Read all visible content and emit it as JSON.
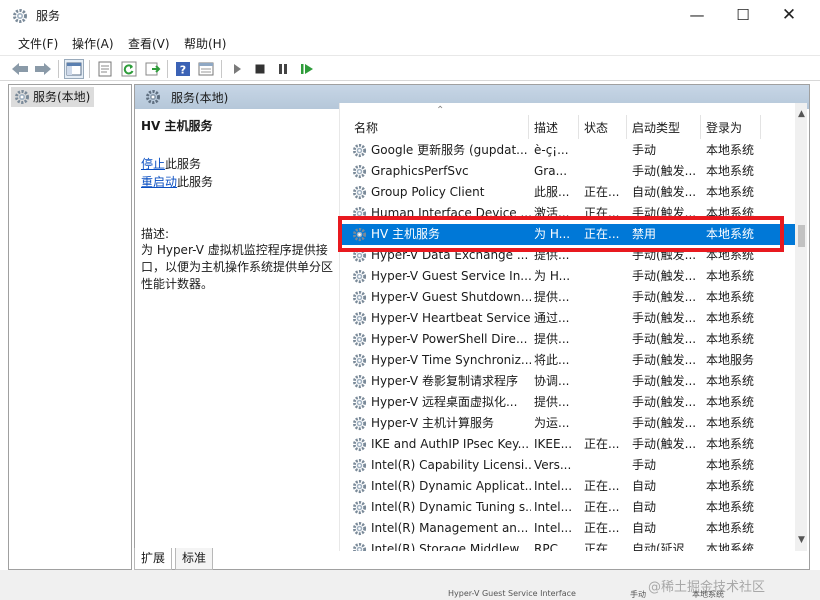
{
  "window": {
    "title": "服务",
    "min_icon": "minimize-icon",
    "max_icon": "maximize-icon",
    "close_icon": "close-icon"
  },
  "menu": [
    "文件(F)",
    "操作(A)",
    "查看(V)",
    "帮助(H)"
  ],
  "toolbar": [
    "back-icon",
    "forward-icon",
    "console-tree-icon",
    "properties-icon",
    "refresh-icon",
    "export-icon",
    "help-icon",
    "details-icon",
    "start-icon",
    "stop-icon",
    "pause-icon",
    "restart-icon"
  ],
  "tree": {
    "item": "服务(本地)"
  },
  "panel": {
    "header": "服务(本地)",
    "detail": {
      "title": "HV 主机服务",
      "stop_link": "停止",
      "stop_suffix": "此服务",
      "restart_link": "重启动",
      "restart_suffix": "此服务",
      "desc_label": "描述:",
      "desc": "为 Hyper-V 虚拟机监控程序提供接口，以便为主机操作系统提供单分区性能计数器。"
    }
  },
  "columns": [
    "名称",
    "描述",
    "状态",
    "启动类型",
    "登录为"
  ],
  "rows": [
    {
      "name": "Google 更新服务 (gupdat...",
      "desc": "è‑ç¡...",
      "status": "",
      "start": "手动",
      "logon": "本地系统"
    },
    {
      "name": "GraphicsPerfSvc",
      "desc": "Gra...",
      "status": "",
      "start": "手动(触发...",
      "logon": "本地系统"
    },
    {
      "name": "Group Policy Client",
      "desc": "此服...",
      "status": "正在...",
      "start": "自动(触发...",
      "logon": "本地系统"
    },
    {
      "name": "Human Interface Device ...",
      "desc": "激活...",
      "status": "正在...",
      "start": "手动(触发...",
      "logon": "本地系统"
    },
    {
      "name": "HV 主机服务",
      "desc": "为 H...",
      "status": "正在...",
      "start": "禁用",
      "logon": "本地系统",
      "selected": true
    },
    {
      "name": "Hyper-V Data Exchange ...",
      "desc": "提供...",
      "status": "",
      "start": "手动(触发...",
      "logon": "本地系统"
    },
    {
      "name": "Hyper-V Guest Service In...",
      "desc": "为 H...",
      "status": "",
      "start": "手动(触发...",
      "logon": "本地系统"
    },
    {
      "name": "Hyper-V Guest Shutdown...",
      "desc": "提供...",
      "status": "",
      "start": "手动(触发...",
      "logon": "本地系统"
    },
    {
      "name": "Hyper-V Heartbeat Service",
      "desc": "通过...",
      "status": "",
      "start": "手动(触发...",
      "logon": "本地系统"
    },
    {
      "name": "Hyper-V PowerShell Dire...",
      "desc": "提供...",
      "status": "",
      "start": "手动(触发...",
      "logon": "本地系统"
    },
    {
      "name": "Hyper-V Time Synchroniz...",
      "desc": "将此...",
      "status": "",
      "start": "手动(触发...",
      "logon": "本地服务"
    },
    {
      "name": "Hyper-V 卷影复制请求程序",
      "desc": "协调...",
      "status": "",
      "start": "手动(触发...",
      "logon": "本地系统"
    },
    {
      "name": "Hyper-V 远程桌面虚拟化...",
      "desc": "提供...",
      "status": "",
      "start": "手动(触发...",
      "logon": "本地系统"
    },
    {
      "name": "Hyper-V 主机计算服务",
      "desc": "为运...",
      "status": "",
      "start": "手动(触发...",
      "logon": "本地系统"
    },
    {
      "name": "IKE and AuthIP IPsec Key...",
      "desc": "IKEE...",
      "status": "正在...",
      "start": "手动(触发...",
      "logon": "本地系统"
    },
    {
      "name": "Intel(R) Capability Licensi...",
      "desc": "Vers...",
      "status": "",
      "start": "手动",
      "logon": "本地系统"
    },
    {
      "name": "Intel(R) Dynamic Applicat...",
      "desc": "Intel...",
      "status": "正在...",
      "start": "自动",
      "logon": "本地系统"
    },
    {
      "name": "Intel(R) Dynamic Tuning s...",
      "desc": "Intel...",
      "status": "正在...",
      "start": "自动",
      "logon": "本地系统"
    },
    {
      "name": "Intel(R) Management an...",
      "desc": "Intel...",
      "status": "正在...",
      "start": "自动",
      "logon": "本地系统"
    },
    {
      "name": "Intel(R) Storage Middlew...",
      "desc": "RPC...",
      "status": "正在...",
      "start": "自动(延迟...",
      "logon": "本地系统"
    }
  ],
  "tabs": [
    "扩展",
    "标准"
  ],
  "watermark": "@稀土掘金技术社区",
  "status_row": {
    "name": "Hyper-V Guest Service Interface",
    "start": "手动",
    "logon": "本地系统"
  }
}
